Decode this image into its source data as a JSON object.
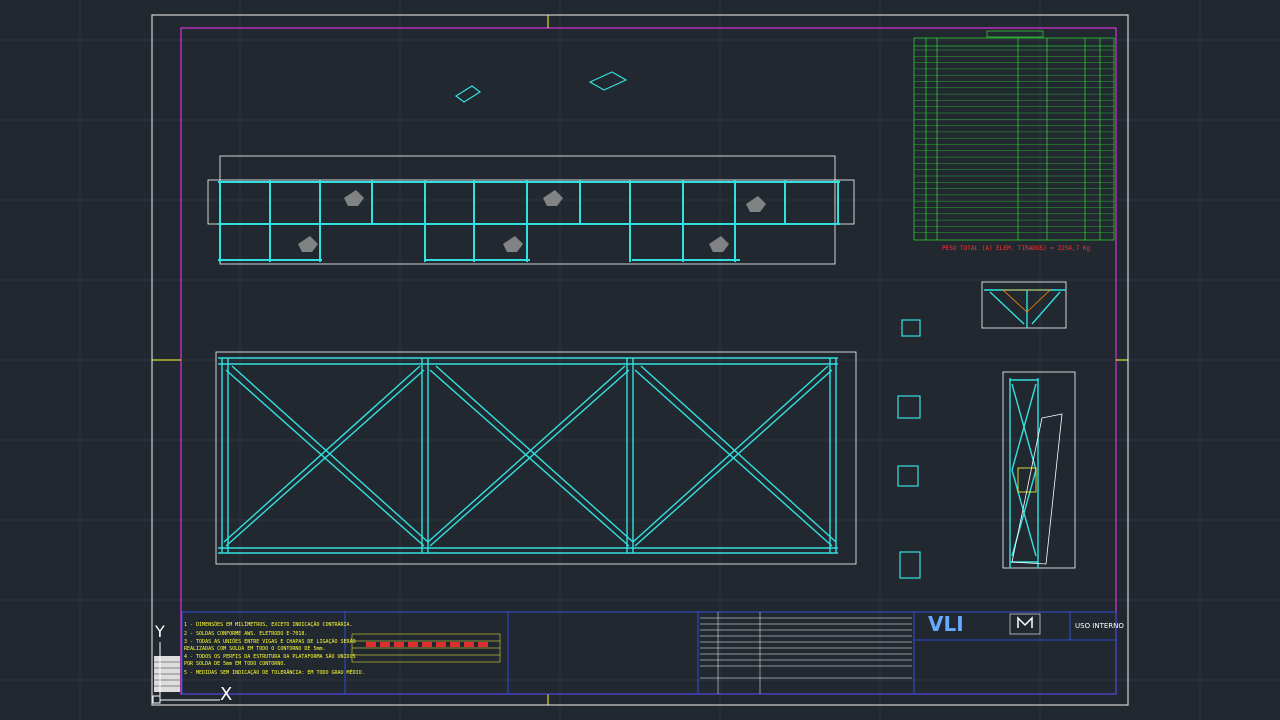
{
  "drawing": {
    "logo_text": "VLI",
    "usage_label": "USO INTERNO",
    "total_weight": "PESO TOTAL (A) ELEM. TIRADOS) = 2254,7 Kg",
    "ucs_y": "Y",
    "ucs_x": "X"
  },
  "notes": [
    "1 - DIMENSÕES EM MILÍMETROS, EXCETO INDICAÇÃO CONTRÁRIA.",
    "2 - SOLDAS CONFORME AWS. ELETRODO E-7018.",
    "3 - TODAS AS UNIÕES ENTRE VIGAS E CHAPAS DE LIGAÇÃO SERÃO",
    "    REALIZADAS COM SOLDA EM TODO O CONTORNO DE 5mm.",
    "4 - TODOS OS PERFIS DA ESTRUTURA DA PLATAFORMA SÃO UNIDOS",
    "    POR SOLDA DE 5mm EM TODO CONTORNO.",
    "5 - MEDIDAS SEM INDICAÇÃO DE TOLERÂNCIA: EM TODO GRAU MÉDIO."
  ],
  "colors": {
    "background": "#212830",
    "frame": "#cfcfcf",
    "border": "#ff33ff",
    "steel": "#33e0e0",
    "dimension": "#ffff33",
    "tag": "#ff33ff",
    "table": "#33ff33",
    "title_block": "#3355ff"
  }
}
